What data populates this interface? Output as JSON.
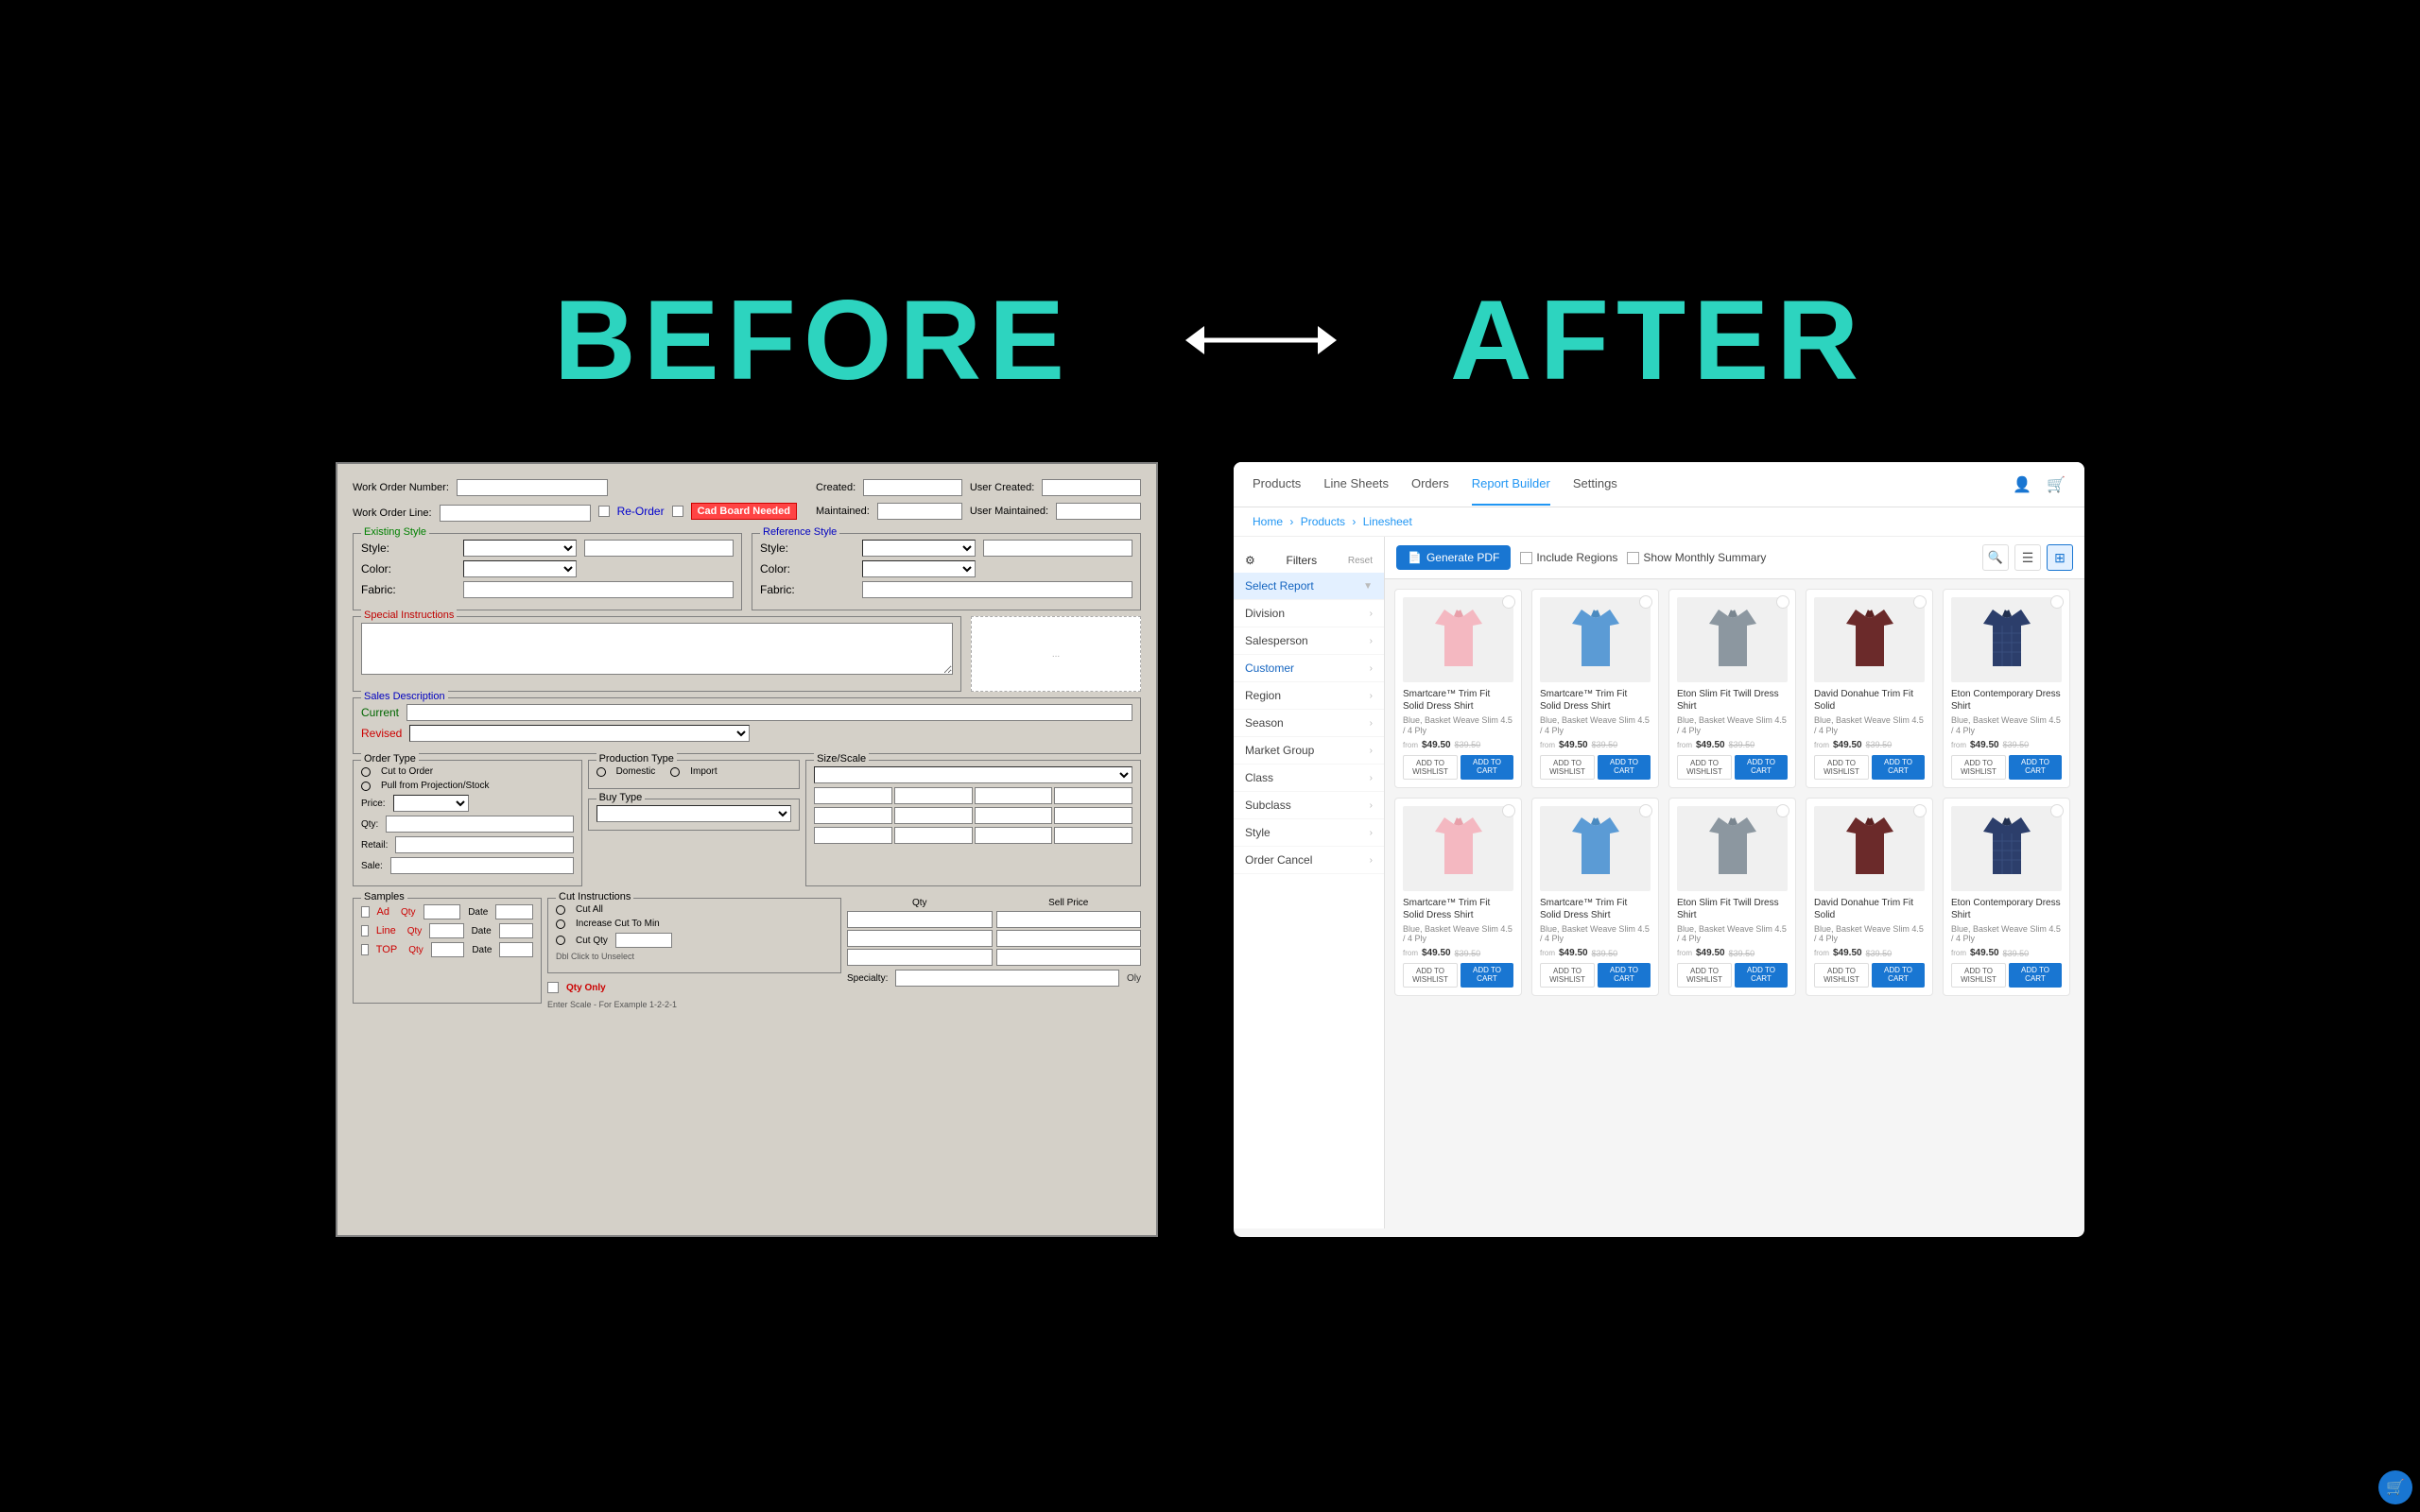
{
  "header": {
    "before_label": "BEFORE",
    "after_label": "AFTER"
  },
  "before_panel": {
    "work_order_number_label": "Work Order Number:",
    "work_order_line_label": "Work Order Line:",
    "reorder_label": "Re-Order",
    "cad_board_label": "Cad Board Needed",
    "created_label": "Created:",
    "maintained_label": "Maintained:",
    "user_created_label": "User Created:",
    "user_maintained_label": "User Maintained:",
    "existing_style_title": "Existing Style",
    "style_label": "Style:",
    "color_label": "Color:",
    "fabric_label": "Fabric:",
    "reference_style_title": "Reference Style",
    "special_instructions_title": "Special Instructions",
    "sales_description_title": "Sales Description",
    "current_label": "Current",
    "revised_label": "Revised",
    "order_type_title": "Order Type",
    "cut_to_order": "Cut to Order",
    "pull_from_proj": "Pull from Projection/Stock",
    "production_type_title": "Production Type",
    "domestic": "Domestic",
    "import": "Import",
    "buy_type_title": "Buy Type",
    "size_scale_title": "Size/Scale",
    "price_label": "Price:",
    "qty_label": "Qty:",
    "retail_label": "Retail:",
    "sale_label": "Sale:",
    "samples_title": "Samples",
    "ad_label": "Ad",
    "qty_s": "Qty",
    "date_label": "Date",
    "line_label": "Line",
    "top_label": "TOP",
    "cut_instructions_title": "Cut Instructions",
    "cut_all": "Cut All",
    "increase_cut": "Increase Cut To Min",
    "cut_qty": "Cut Qty",
    "qty_only": "Qty Only",
    "dbl_click": "Dbl Click to Unselect",
    "enter_scale": "Enter Scale - For Example 1-2-2-1",
    "qty_col": "Qty",
    "sell_price_col": "Sell Price",
    "specialty_label": "Specialty:",
    "oly_text": "Oly"
  },
  "after_panel": {
    "nav": {
      "products": "Products",
      "line_sheets": "Line Sheets",
      "orders": "Orders",
      "report_builder": "Report Builder",
      "settings": "Settings"
    },
    "breadcrumb": {
      "home": "Home",
      "products": "Products",
      "linesheet": "Linesheet"
    },
    "toolbar": {
      "filters_label": "Filters",
      "reset_label": "Reset",
      "generate_pdf_label": "Generate PDF",
      "include_regions_label": "Include Regions",
      "show_monthly_label": "Show Monthly Summary"
    },
    "sidebar": {
      "select_report": "Select Report",
      "division": "Division",
      "salesperson": "Salesperson",
      "customer": "Customer",
      "region": "Region",
      "season": "Season",
      "market_group": "Market Group",
      "class": "Class",
      "subclass": "Subclass",
      "style": "Style",
      "order_cancel": "Order Cancel"
    },
    "products": [
      {
        "name": "Smartcare™ Trim Fit Solid Dress Shirt",
        "price_from": "from",
        "price": "$49.50",
        "price_slash": "$39.50",
        "color": "pink",
        "btn1": "ADD TO WISHLIST",
        "btn2": "ADD TO CART"
      },
      {
        "name": "Smartcare™ Trim Fit Solid Dress Shirt",
        "price_from": "from",
        "price": "$49.50",
        "price_slash": "$39.50",
        "color": "blue",
        "btn1": "ADD TO WISHLIST",
        "btn2": "ADD TO CART"
      },
      {
        "name": "Eton Slim Fit Twill Dress Shirt",
        "price_from": "from",
        "price": "$49.50",
        "price_slash": "$39.50",
        "color": "gray",
        "btn1": "ADD TO WISHLIST",
        "btn2": "ADD TO CART"
      },
      {
        "name": "David Donahue Trim Fit Solid",
        "price_from": "from",
        "price": "$49.50",
        "price_slash": "$39.50",
        "color": "darkred",
        "btn1": "ADD TO WISHLIST",
        "btn2": "ADD TO CART"
      },
      {
        "name": "Eton Contemporary Dress Shirt",
        "price_from": "from",
        "price": "$49.50",
        "price_slash": "$39.50",
        "color": "darkblue",
        "btn1": "ADD TO WISHLIST",
        "btn2": "ADD TO CART"
      }
    ]
  }
}
